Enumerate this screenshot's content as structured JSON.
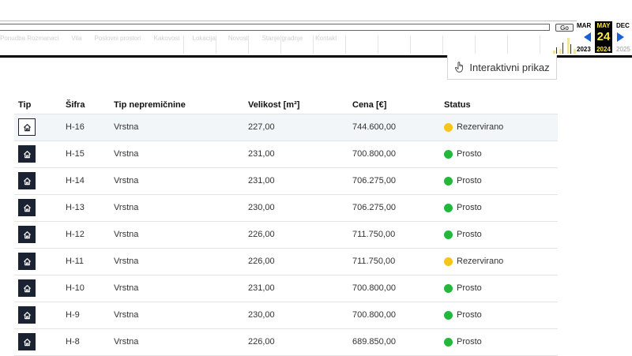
{
  "wayback": {
    "go_label": "Go",
    "ghost_nav": [
      "Ponudba Rozmanaci",
      "Vila",
      "Poslovni prostori",
      "Kakovost",
      "Lokacija",
      "Novosti",
      "Stanje gradnje",
      "Kontakt"
    ],
    "prev_month": "MAR",
    "current_month": "MAY",
    "next_month": "DEC",
    "current_day": "24",
    "prev_year": "2023",
    "current_year": "2024",
    "next_year": "2025",
    "colors": {
      "accent": "#ffeb3b",
      "arrow": "#1662d8"
    }
  },
  "interactive_button": {
    "label": "Interaktivni prikaz",
    "icon": "hand-pointer-icon"
  },
  "table": {
    "columns": [
      "Tip",
      "Šifra",
      "Tip nepremičnine",
      "Velikost [m²]",
      "Cena [€]",
      "Status"
    ],
    "rows": [
      {
        "code": "H-16",
        "type": "Vrstna",
        "size": "227,00",
        "price": "744.600,00",
        "status": "Rezervirano",
        "status_color": "#f5c518"
      },
      {
        "code": "H-15",
        "type": "Vrstna",
        "size": "231,00",
        "price": "700.800,00",
        "status": "Prosto",
        "status_color": "#22b83a"
      },
      {
        "code": "H-14",
        "type": "Vrstna",
        "size": "231,00",
        "price": "706.275,00",
        "status": "Prosto",
        "status_color": "#22b83a"
      },
      {
        "code": "H-13",
        "type": "Vrstna",
        "size": "230,00",
        "price": "706.275,00",
        "status": "Prosto",
        "status_color": "#22b83a"
      },
      {
        "code": "H-12",
        "type": "Vrstna",
        "size": "226,00",
        "price": "711.750,00",
        "status": "Prosto",
        "status_color": "#22b83a"
      },
      {
        "code": "H-11",
        "type": "Vrstna",
        "size": "226,00",
        "price": "711.750,00",
        "status": "Rezervirano",
        "status_color": "#f5c518"
      },
      {
        "code": "H-10",
        "type": "Vrstna",
        "size": "231,00",
        "price": "700.800,00",
        "status": "Prosto",
        "status_color": "#22b83a"
      },
      {
        "code": "H-9",
        "type": "Vrstna",
        "size": "230,00",
        "price": "700.800,00",
        "status": "Prosto",
        "status_color": "#22b83a"
      },
      {
        "code": "H-8",
        "type": "Vrstna",
        "size": "226,00",
        "price": "689.850,00",
        "status": "Prosto",
        "status_color": "#22b83a"
      }
    ]
  }
}
